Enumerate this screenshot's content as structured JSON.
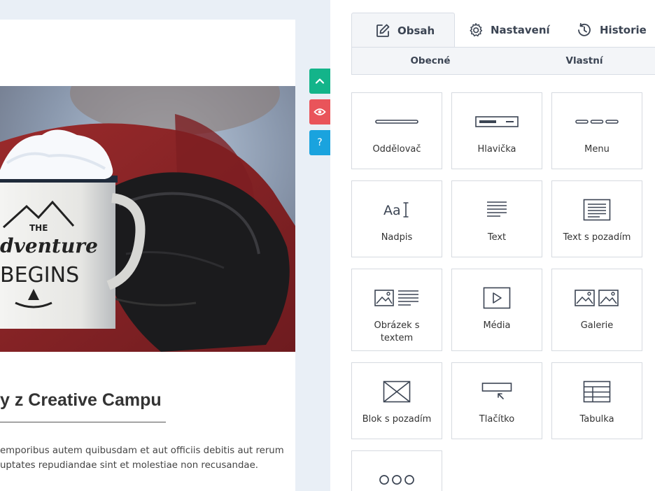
{
  "editor": {
    "hero_image": {
      "alt": "Enamel mug with snow",
      "mug_text_top": "THE",
      "mug_text_mid": "dventure",
      "mug_text_bottom": "BEGINS"
    },
    "heading": "y z Creative Campu",
    "body_line1": "emporibus autem quibusdam et aut officiis debitis aut rerum",
    "body_line2": "uptates repudiandae sint et molestiae non recusandae.",
    "side_buttons": {
      "help": "?"
    }
  },
  "panel": {
    "tabs": [
      {
        "label": "Obsah",
        "icon": "edit-icon"
      },
      {
        "label": "Nastavení",
        "icon": "gear-icon"
      },
      {
        "label": "Historie",
        "icon": "history-icon"
      }
    ],
    "subtabs": [
      {
        "label": "Obecné"
      },
      {
        "label": "Vlastní"
      }
    ],
    "blocks": [
      {
        "label": "Oddělovač",
        "icon": "divider-icon"
      },
      {
        "label": "Hlavička",
        "icon": "header-icon"
      },
      {
        "label": "Menu",
        "icon": "menu-icon"
      },
      {
        "label": "Nadpis",
        "icon": "heading-icon",
        "icon_text": "Aa"
      },
      {
        "label": "Text",
        "icon": "text-icon"
      },
      {
        "label": "Text s pozadím",
        "icon": "text-background-icon"
      },
      {
        "label": "Obrázek s textem",
        "icon": "image-text-icon"
      },
      {
        "label": "Média",
        "icon": "media-icon"
      },
      {
        "label": "Galerie",
        "icon": "gallery-icon"
      },
      {
        "label": "Blok s pozadím",
        "icon": "background-block-icon"
      },
      {
        "label": "Tlačítko",
        "icon": "button-icon"
      },
      {
        "label": "Tabulka",
        "icon": "table-icon"
      },
      {
        "label": "",
        "icon": "more-icon"
      }
    ]
  },
  "colors": {
    "accent_green": "#13b48a",
    "accent_red": "#e9545a",
    "accent_blue": "#1aa3de",
    "icon_stroke": "#3b4453"
  }
}
